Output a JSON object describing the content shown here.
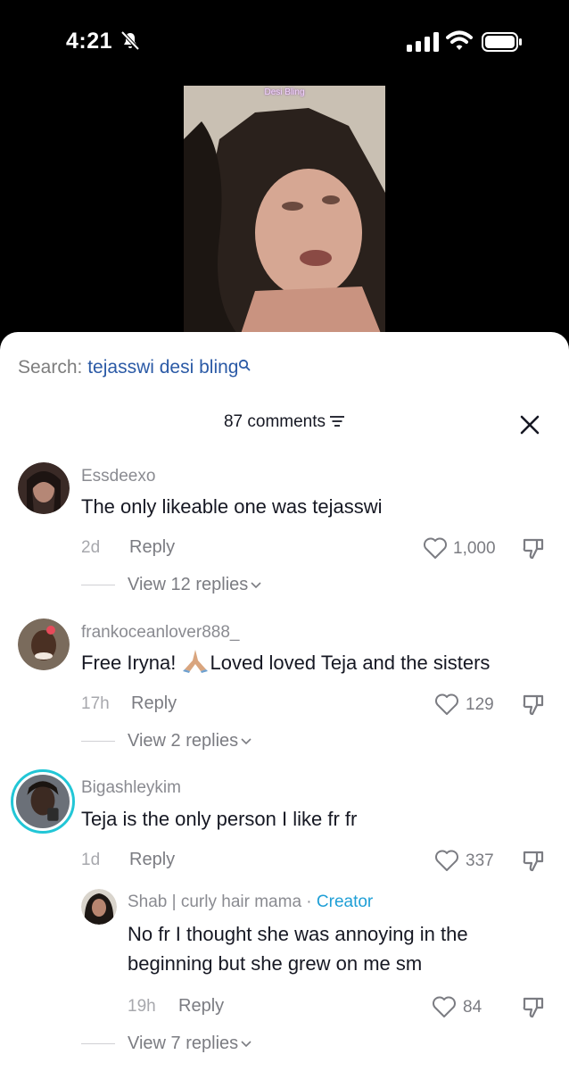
{
  "status_bar": {
    "time": "4:21"
  },
  "video": {
    "caption": "Desi Bling"
  },
  "search": {
    "label": "Search: ",
    "query": "tejasswi desi bling"
  },
  "comments_header": {
    "count_label": "87 comments"
  },
  "comments": [
    {
      "username": "Essdeexo",
      "text": "The only likeable one was tejasswi",
      "age": "2d",
      "reply_label": "Reply",
      "likes": "1,000",
      "view_replies": "View 12 replies"
    },
    {
      "username": "frankoceanlover888_",
      "text_before": "Free Iryna! ",
      "text_after": "Loved loved Teja and the sisters",
      "age": "17h",
      "reply_label": "Reply",
      "likes": "129",
      "view_replies": "View 2 replies"
    },
    {
      "username": "Bigashleykim",
      "text": "Teja is the only person I like fr fr",
      "age": "1d",
      "reply_label": "Reply",
      "likes": "337"
    }
  ],
  "reply": {
    "username": "Shab | curly hair mama",
    "separator": " · ",
    "badge": "Creator",
    "text_line1": "No fr I thought she was annoying in the",
    "text_line2": "beginning but she grew on me sm",
    "age": "19h",
    "reply_label": "Reply",
    "likes": "84",
    "view_replies": "View 7 replies"
  },
  "colors": {
    "accent_link": "#2b5aa6",
    "creator_badge": "#1f9fd6",
    "story_ring": "#22c6d6"
  }
}
